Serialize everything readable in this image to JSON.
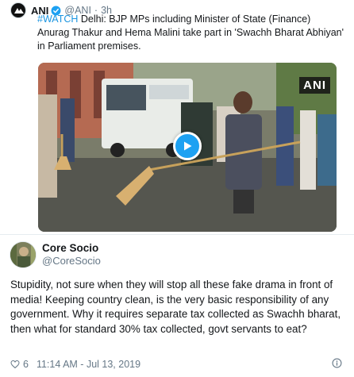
{
  "quoted_tweet": {
    "name": "ANI",
    "handle": "@ANI",
    "separator": "·",
    "time": "3h",
    "hashtag": "#WATCH",
    "text": " Delhi: BJP MPs including Minister of State (Finance) Anurag Thakur and Hema Malini take part in 'Swachh Bharat Abhiyan' in Parliament premises.",
    "video_badge": "ANI",
    "icons": {
      "avatar": "ani-logo-icon",
      "verified": "verified-badge-icon",
      "play": "play-icon",
      "menu": "chevron-down-icon"
    }
  },
  "reply_tweet": {
    "name": "Core Socio",
    "handle": "@CoreSocio",
    "text": "Stupidity, not sure when they will stop all these fake drama in front of media! Keeping country clean, is the very basic responsibility of any government. Why it requires separate tax collected as Swachh bharat, then what for standard 30% tax collected, govt servants to eat?",
    "likes": "6",
    "timestamp": "11:14 AM - Jul 13, 2019",
    "icons": {
      "like": "heart-icon",
      "info": "info-icon",
      "menu": "chevron-down-icon"
    }
  },
  "colors": {
    "link": "#1b95e0",
    "secondary_text": "#657786",
    "play_button": "#1da1f2",
    "divider": "#e6ecf0"
  }
}
